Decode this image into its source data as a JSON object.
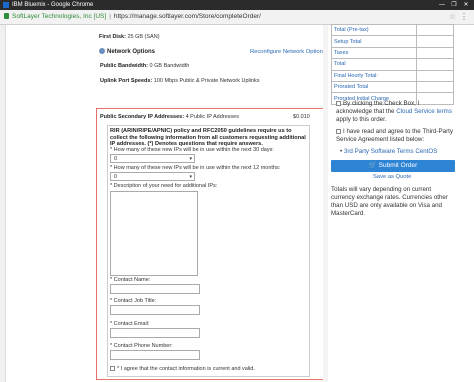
{
  "window": {
    "title": "IBM Bluemix - Google Chrome",
    "controls": [
      "—",
      "❐",
      "✕"
    ]
  },
  "address_bar": {
    "site": "SoftLayer Technologies, Inc [US]",
    "separator": "|",
    "url": "https://manage.softlayer.com/Store/completeOrder/"
  },
  "left": {
    "first_disk_label": "First Disk:",
    "first_disk_value": "25 GB (SAN)",
    "network_options": "Network Options",
    "reconfigure_link": "Reconfigure Network Options",
    "public_bandwidth_label": "Public Bandwidth:",
    "public_bandwidth_value": "0 GB Bandwidth",
    "uplink_label": "Uplink Port Speeds:",
    "uplink_value": "100 Mbps Public & Private Network Uplinks",
    "secondary_label": "Public Secondary IP Addresses:",
    "secondary_value": "4 Public IP Addresses",
    "secondary_price": "$0.010"
  },
  "form": {
    "policy_text": "RIR (ARIN/RIPE/APNIC) policy and RFC2050 guidelines require us to collect the following information from all customers requesting additional IP addresses. (*) Denotes questions that require answers.",
    "q1": "* How many of these new IPs will be in use within the next 30 days:",
    "q1_value": "0",
    "q2": "* How many of these new IPs will be in use within the next 12 months:",
    "q2_value": "0",
    "q3": "* Description of your need for additional IPs:",
    "contact_name": "* Contact Name:",
    "contact_job": "* Contact Job Title:",
    "contact_email": "* Contact Email:",
    "contact_phone": "* Contact Phone Number:",
    "agree_contact": "* I agree that the contact information is current and valid."
  },
  "summary": {
    "rows": [
      {
        "label": "Total (Pre-tax)",
        "value": ""
      },
      {
        "label": "Setup Total",
        "value": ""
      },
      {
        "label": "Taxes",
        "value": ""
      },
      {
        "label": "Total",
        "value": ""
      },
      {
        "label": "Final Hourly Total:",
        "value": ""
      },
      {
        "label": "Prorated Total",
        "value": ""
      },
      {
        "label": "Prorated Initial Charge",
        "value": ""
      }
    ],
    "check1_pre": "By clicking the Check Box, I acknowledge that the ",
    "check1_link": "Cloud Service terms",
    "check1_post": " apply to this order.",
    "check2": "I have read and agree to the Third-Party Service Agreement listed below:",
    "tp_link": "3rd Party Software Terms CentOS",
    "submit": "Submit Order",
    "save_quote": "Save as Quote",
    "note": "Totals will vary depending on current currency exchange rates. Currencies other than USD are only available on Visa and MasterCard."
  }
}
